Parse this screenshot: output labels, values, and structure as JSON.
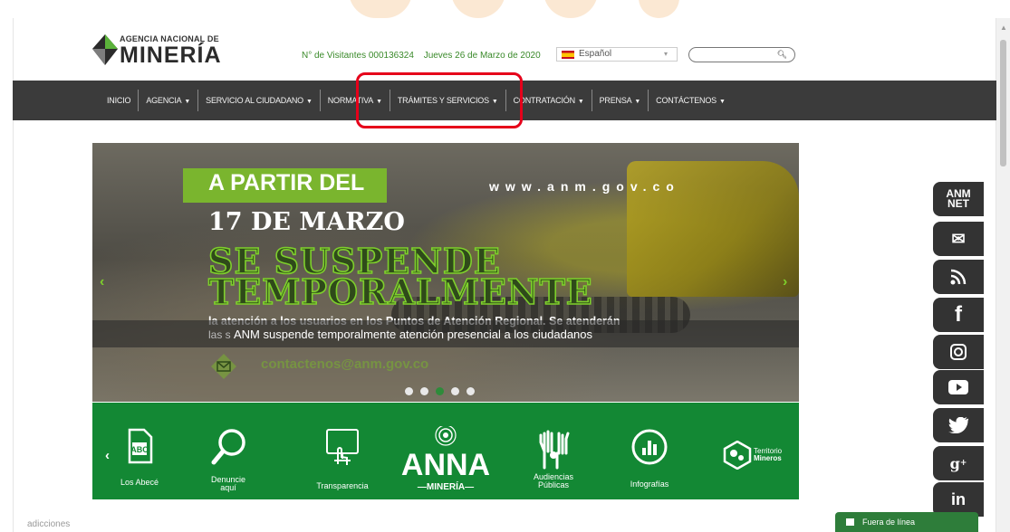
{
  "header": {
    "logo_top": "AGENCIA NACIONAL DE",
    "logo_main": "MINERÍA",
    "visitors": "N° de Visitantes 000136324",
    "date": "Jueves 26 de Marzo de 2020",
    "language": "Español",
    "search_placeholder": ""
  },
  "nav": {
    "items": [
      {
        "label": "INICIO",
        "dropdown": false
      },
      {
        "label": "AGENCIA",
        "dropdown": true
      },
      {
        "label": "SERVICIO AL CIUDADANO",
        "dropdown": true
      },
      {
        "label": "NORMATIVA",
        "dropdown": true
      },
      {
        "label": "TRÁMITES Y SERVICIOS",
        "dropdown": true
      },
      {
        "label": "CONTRATACIÓN",
        "dropdown": true
      },
      {
        "label": "PRENSA",
        "dropdown": true
      },
      {
        "label": "CONTÁCTENOS",
        "dropdown": true
      }
    ],
    "highlighted_item": "TRÁMITES Y SERVICIOS",
    "highlight_color": "#e6001a"
  },
  "hero": {
    "tab_text": "A PARTIR DEL",
    "url": "www.anm.gov.co",
    "date_text": "17 DE MARZO",
    "suspend_line1": "SE SUSPENDE",
    "suspend_line2": "TEMPORALMENTE",
    "atencion": "la atención a los usuarios en los Puntos de Atención Regional. Se atenderán",
    "las": "las s",
    "caption": "ANM suspende temporalmente atención presencial a los ciudadanos",
    "contact": "contactenos@anm.gov.co",
    "slides_count": 5,
    "active_slide": 3,
    "prev_arrow": "‹",
    "next_arrow": "›",
    "accent": "#7ab52e"
  },
  "services": {
    "prev_arrow": "‹",
    "items": [
      {
        "label": "Los Abecé",
        "icon": "abc-document-icon"
      },
      {
        "label": "Denuncie aquí",
        "icon": "magnifier-icon"
      },
      {
        "label": "Transparencia",
        "icon": "touch-screen-icon"
      },
      {
        "label": "ANNA MINERÍA",
        "icon": "anna-logo-icon"
      },
      {
        "label": "Audiencias Públicas",
        "icon": "raised-hands-icon"
      },
      {
        "label": "Infografías",
        "icon": "chart-circle-icon"
      },
      {
        "label": "Territorio Mineros",
        "icon": "territorio-logo-icon"
      }
    ],
    "band_color": "#138834"
  },
  "social": [
    {
      "name": "anm-net-icon",
      "text": "ANM NET"
    },
    {
      "name": "mail-icon",
      "text": "✉"
    },
    {
      "name": "rss-icon",
      "text": "RSS"
    },
    {
      "name": "facebook-icon",
      "text": "f"
    },
    {
      "name": "instagram-icon",
      "text": "◎"
    },
    {
      "name": "youtube-icon",
      "text": "▶"
    },
    {
      "name": "twitter-icon",
      "text": "t"
    },
    {
      "name": "googleplus-icon",
      "text": "g+"
    },
    {
      "name": "linkedin-icon",
      "text": "in"
    }
  ],
  "footer": {
    "left_text": "adicciones",
    "chat_text": "Fuera de línea"
  }
}
